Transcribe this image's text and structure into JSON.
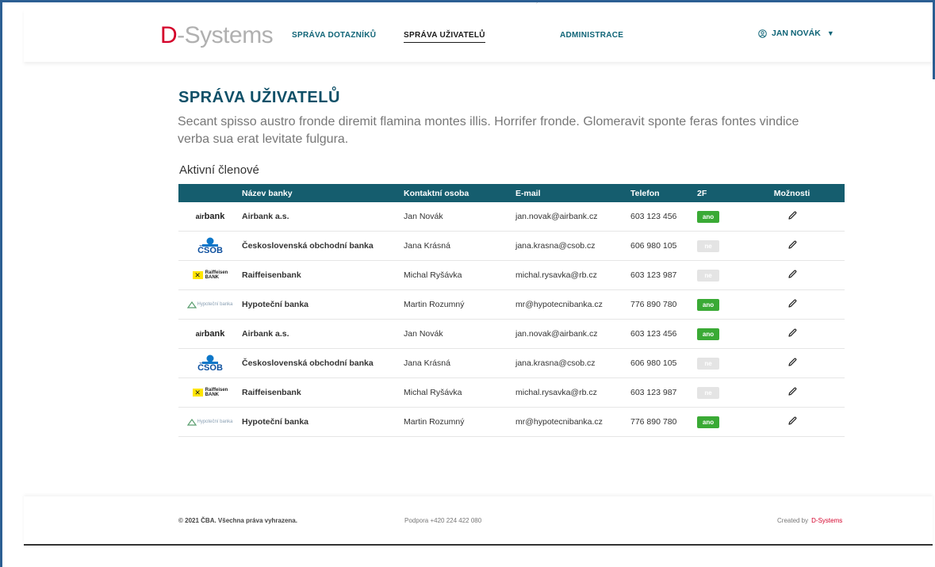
{
  "header": {
    "logo_d": "D",
    "logo_rest": "-Systems",
    "nav": [
      {
        "label": "SPRÁVA DOTAZNÍKŮ"
      },
      {
        "label": "SPRÁVA UŽIVATELŮ"
      },
      {
        "label": "ADMINISTRACE"
      }
    ],
    "user_name": "JAN NOVÁK",
    "corner_mark": "´"
  },
  "main": {
    "title": "SPRÁVA UŽIVATELŮ",
    "description": "Secant spisso austro fronde diremit flamina montes illis. Horrifer fronde. Glomeravit sponte feras fontes vindice verba sua erat levitate fulgura.",
    "section_label": "Aktivní členové",
    "columns": [
      "Název banky",
      "Kontaktní osoba",
      "E-mail",
      "Telefon",
      "2F",
      "Možnosti"
    ],
    "rows": [
      {
        "logo": "airbank",
        "bank": "Airbank a.s.",
        "contact": "Jan Novák",
        "email": "jan.novak@airbank.cz",
        "phone": "603 123 456",
        "twofa": "ano",
        "twofa_on": true
      },
      {
        "logo": "csob",
        "bank": "Československá obchodní banka",
        "contact": "Jana Krásná",
        "email": "jana.krasna@csob.cz",
        "phone": "606 980 105",
        "twofa": "ne",
        "twofa_on": false
      },
      {
        "logo": "raiffeisen",
        "bank": "Raiffeisenbank",
        "contact": "Michal Ryšávka",
        "email": "michal.rysavka@rb.cz",
        "phone": "603 123 987",
        "twofa": "ne",
        "twofa_on": false
      },
      {
        "logo": "hypotecni",
        "bank": "Hypoteční banka",
        "contact": "Martin Rozumný",
        "email": "mr@hypotecnibanka.cz",
        "phone": "776 890 780",
        "twofa": "ano",
        "twofa_on": true
      },
      {
        "logo": "airbank",
        "bank": "Airbank a.s.",
        "contact": "Jan Novák",
        "email": "jan.novak@airbank.cz",
        "phone": "603 123 456",
        "twofa": "ano",
        "twofa_on": true
      },
      {
        "logo": "csob",
        "bank": "Československá obchodní banka",
        "contact": "Jana Krásná",
        "email": "jana.krasna@csob.cz",
        "phone": "606 980 105",
        "twofa": "ne",
        "twofa_on": false
      },
      {
        "logo": "raiffeisen",
        "bank": "Raiffeisenbank",
        "contact": "Michal Ryšávka",
        "email": "michal.rysavka@rb.cz",
        "phone": "603 123 987",
        "twofa": "ne",
        "twofa_on": false
      },
      {
        "logo": "hypotecni",
        "bank": "Hypoteční banka",
        "contact": "Martin Rozumný",
        "email": "mr@hypotecnibanka.cz",
        "phone": "776 890 780",
        "twofa": "ano",
        "twofa_on": true
      }
    ],
    "logo_texts": {
      "airbank_sup": "air",
      "airbank_main": "bank",
      "csob": "ČSOB",
      "raiffeisen_1": "Raiffeisen",
      "raiffeisen_2": "BANK",
      "hypotecni": "Hypoteční banka"
    }
  },
  "footer": {
    "copyright": "© 2021 ČBA. Všechna práva vyhrazena.",
    "support": "Podpora +420 224 422 080",
    "created_by": "Created by",
    "brand": "D-Systems"
  },
  "colors": {
    "brand_red": "#d4002a",
    "teal": "#155d6e",
    "nav_teal": "#0f6477",
    "badge_on": "#3aaa35",
    "badge_off": "#e4e4e4"
  }
}
